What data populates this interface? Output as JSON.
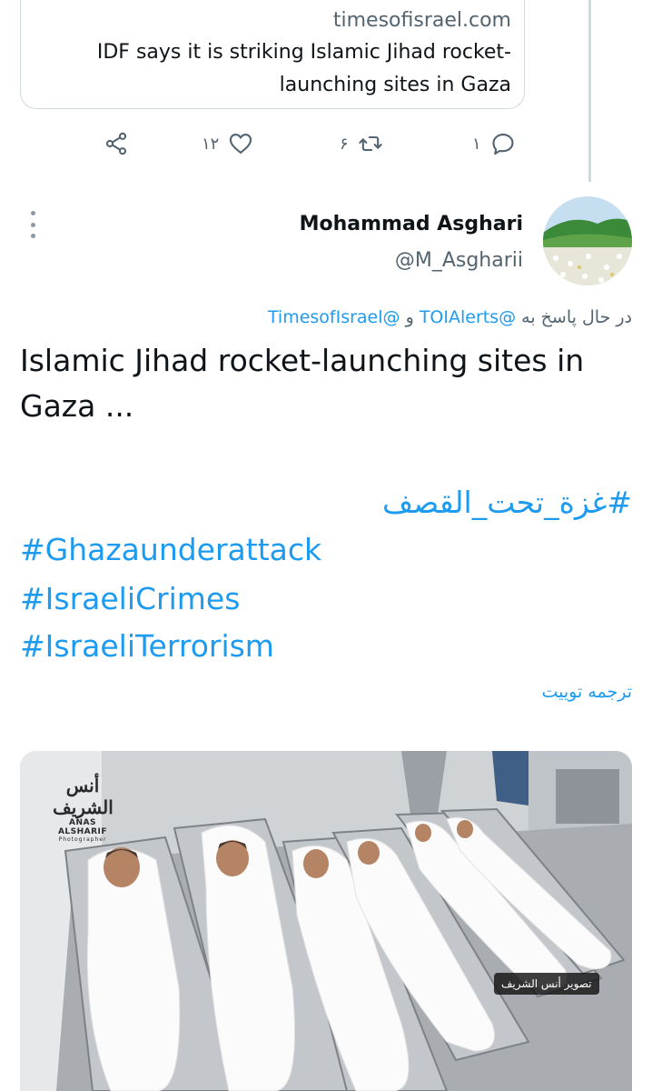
{
  "quoted_card": {
    "domain": "timesofisrael.com",
    "title": "IDF says it is striking Islamic Jihad rocket-launching sites in Gaza"
  },
  "actions": {
    "reply_count": "۱",
    "retweet_count": "۶",
    "like_count": "۱۲"
  },
  "reply_tweet": {
    "display_name": "Mohammad Asghari",
    "handle": "@M_Asgharii",
    "replying_prefix": "در حال پاسخ به",
    "mention_1": "@TOIAlerts",
    "conjunction": "و",
    "mention_2": "@TimesofIsrael",
    "text": "Islamic Jihad rocket-launching sites in Gaza ...",
    "hashtags": [
      "#غزة_تحت_القصف",
      "#Ghazaunderattack",
      "#IsraeliCrimes",
      "#IsraeliTerrorism"
    ],
    "translate_label": "ترجمه توییت"
  },
  "media": {
    "watermark_logo": "أنس الشريف",
    "watermark_name": "ANAS ALSHARIF",
    "watermark_sub": "Photographer",
    "caption": "تصوير أنس الشريف"
  },
  "colors": {
    "link": "#1d9bf0",
    "muted": "#536471",
    "border": "#cfd9de"
  }
}
